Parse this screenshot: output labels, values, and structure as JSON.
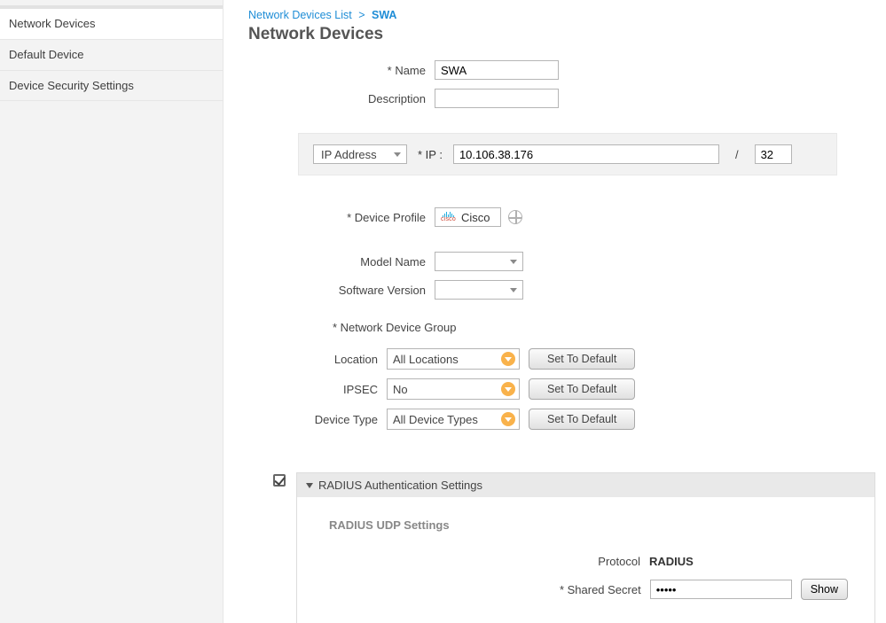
{
  "sidebar": {
    "items": [
      {
        "label": "Network Devices",
        "active": true
      },
      {
        "label": "Default Device"
      },
      {
        "label": "Device Security Settings"
      }
    ]
  },
  "breadcrumb": {
    "parent": "Network Devices List",
    "sep": ">",
    "current": "SWA"
  },
  "page_title": "Network Devices",
  "form": {
    "name_label": "Name",
    "name_value": "SWA",
    "desc_label": "Description",
    "desc_value": ""
  },
  "ip": {
    "mode_label": "IP Address",
    "field_label": "* IP :",
    "value": "10.106.38.176",
    "mask_sep": "/",
    "mask": "32"
  },
  "profile": {
    "label": "Device Profile",
    "value": "Cisco"
  },
  "model": {
    "label": "Model Name",
    "value": ""
  },
  "software": {
    "label": "Software Version",
    "value": ""
  },
  "ndg": {
    "section_label": "*  Network Device Group",
    "location_label": "Location",
    "location_value": "All Locations",
    "ipsec_label": "IPSEC",
    "ipsec_value": "No",
    "devtype_label": "Device Type",
    "devtype_value": "All Device Types",
    "set_default": "Set To Default"
  },
  "radius": {
    "header": "RADIUS Authentication Settings",
    "sub": "RADIUS UDP Settings",
    "protocol_label": "Protocol",
    "protocol_value": "RADIUS",
    "secret_label": "* Shared Secret",
    "secret_value": "•••••",
    "show": "Show"
  }
}
